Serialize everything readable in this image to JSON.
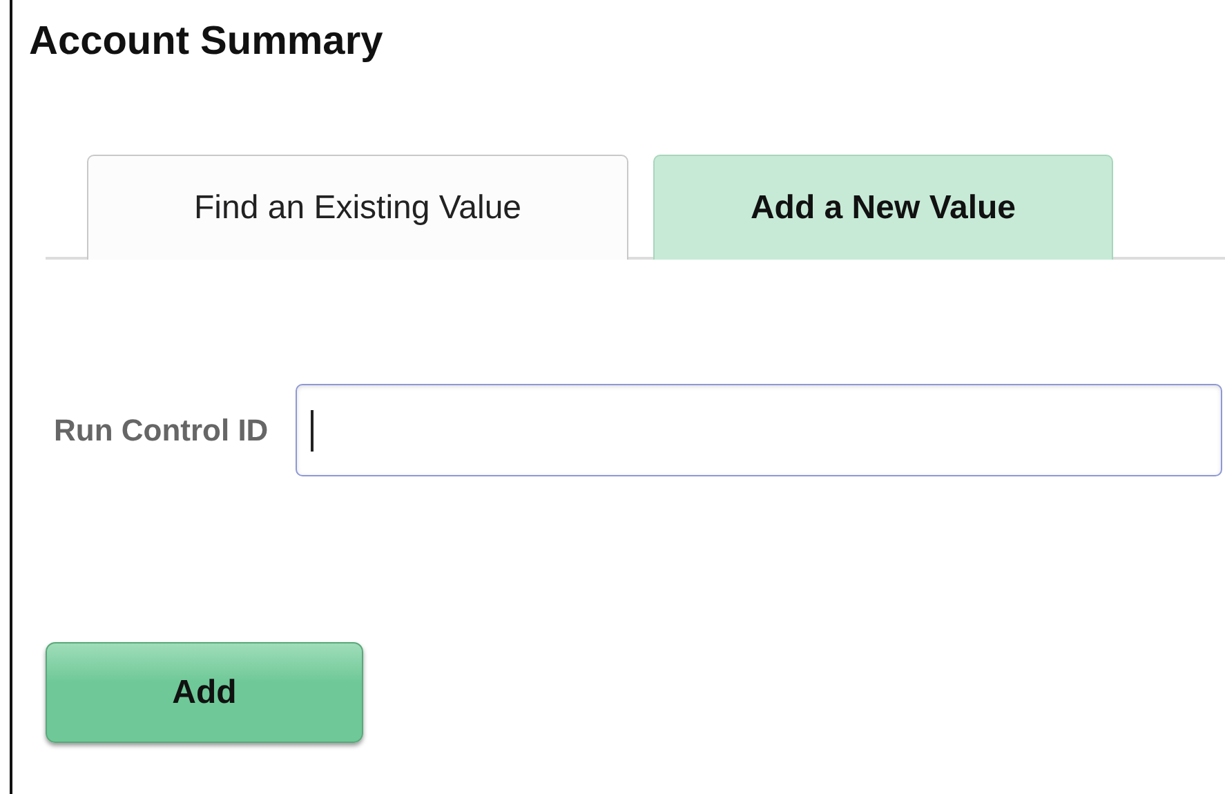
{
  "title": "Account Summary",
  "tabs": [
    {
      "label": "Find an Existing Value",
      "selected": false
    },
    {
      "label": "Add a New Value",
      "selected": true
    }
  ],
  "field": {
    "label": "Run Control ID",
    "focused": true
  },
  "buttons": [
    "Add"
  ]
}
